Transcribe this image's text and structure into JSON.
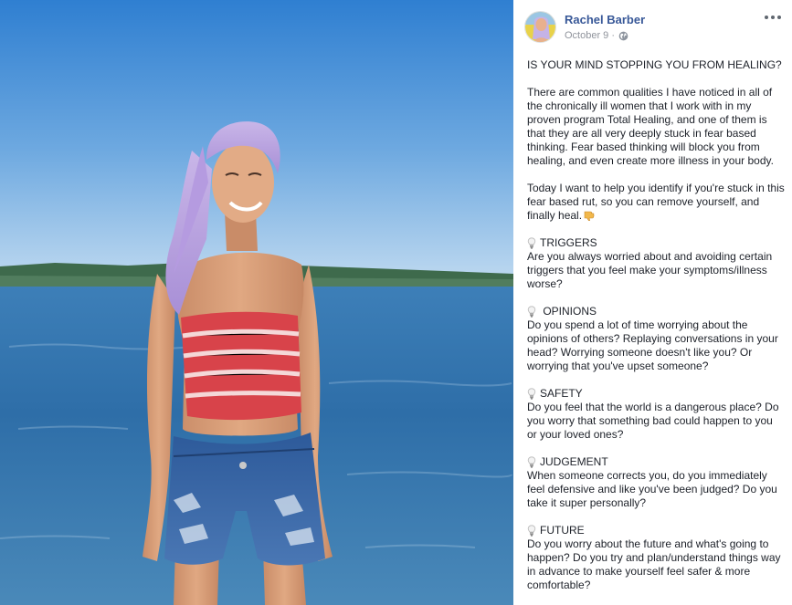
{
  "photo": {
    "alt_icon": "photo-of-woman-by-sea"
  },
  "post": {
    "author_name": "Rachel Barber",
    "date": "October 9",
    "separator": "·",
    "privacy_icon": "globe-icon",
    "more_icon": "more-options-icon",
    "headline": "IS YOUR MIND STOPPING YOU FROM HEALING?",
    "intro": "There are common qualities I have noticed in all of the chronically ill women that I work with in my proven program Total Healing, and one of them is that they are all very deeply stuck in fear based thinking. Fear based thinking will block you from healing, and even create more illness in your body.",
    "today": "Today I want to help you identify if you're stuck in this fear based rut, so you can remove yourself, and finally heal.",
    "sections": [
      {
        "title": "TRIGGERS",
        "text": "Are you always worried about and avoiding certain triggers that you feel make your symptoms/illness worse?"
      },
      {
        "title": " OPINIONS",
        "text": "Do you spend a lot of time worrying about the opinions of others? Replaying conversations in your head? Worrying someone doesn't like you? Or worrying that you've upset someone?"
      },
      {
        "title": "SAFETY",
        "text": "Do you feel that the world is a dangerous place? Do you worry that something bad could happen to you or your loved ones?"
      },
      {
        "title": "JUDGEMENT",
        "text": "When someone corrects you, do you immediately feel defensive and like you've been judged? Do you take it super personally?"
      },
      {
        "title": "FUTURE",
        "text": "Do you worry about the future and what's going to happen? Do you try and plan/understand things way in advance to make yourself feel safer & more comfortable?"
      }
    ]
  },
  "colors": {
    "author_link": "#385898",
    "meta_text": "#90949c",
    "body_text": "#1d2129"
  }
}
